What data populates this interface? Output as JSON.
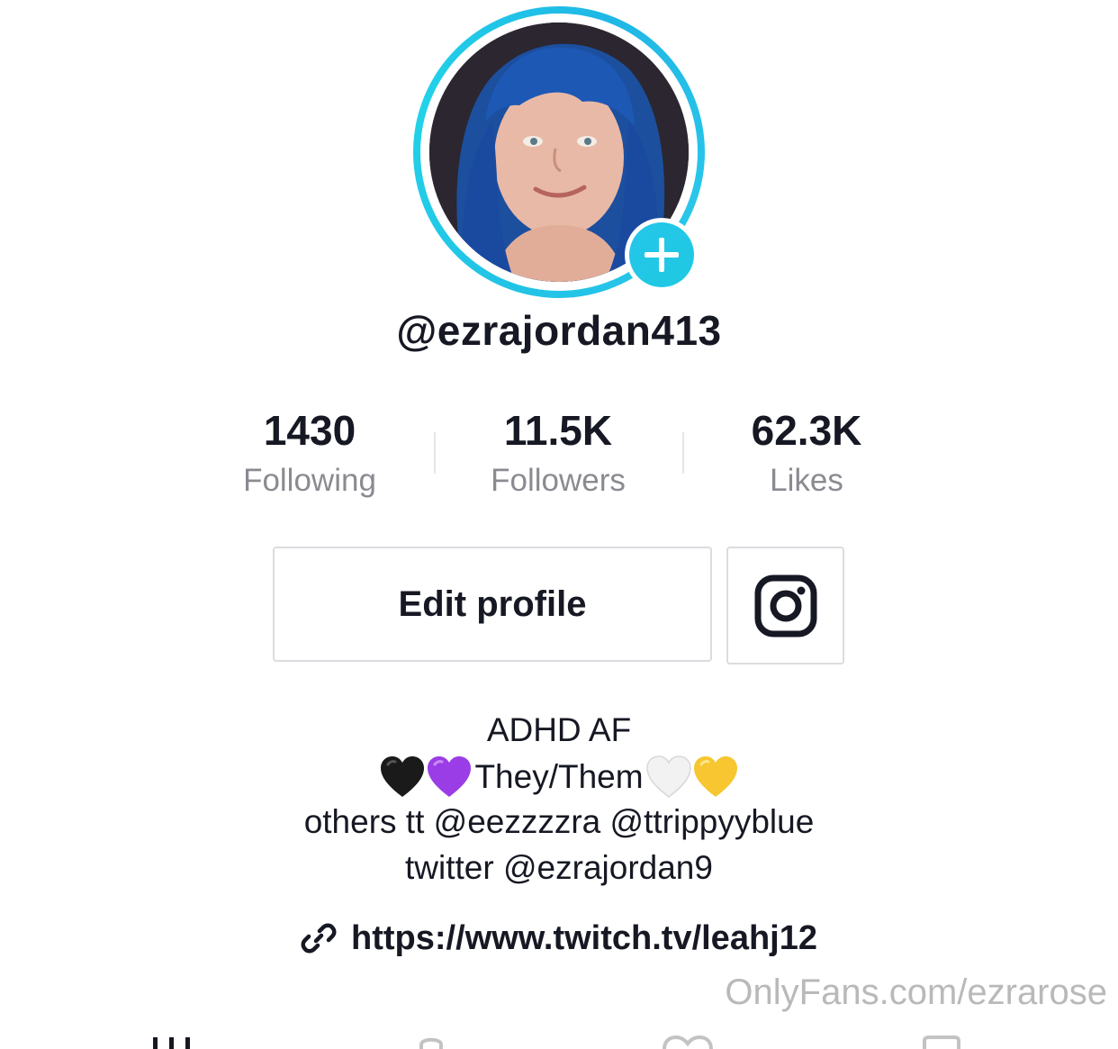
{
  "profile": {
    "username": "@ezrajordan413"
  },
  "stats": [
    {
      "value": "1430",
      "label": "Following"
    },
    {
      "value": "11.5K",
      "label": "Followers"
    },
    {
      "value": "62.3K",
      "label": "Likes"
    }
  ],
  "buttons": {
    "edit_profile": "Edit profile",
    "instagram_icon": "instagram-icon"
  },
  "bio": {
    "line1": "ADHD AF",
    "line2_text": "They/Them",
    "line2_hearts_before": [
      "black",
      "purple"
    ],
    "line2_hearts_after": [
      "white",
      "yellow"
    ],
    "line3": "others tt @eezzzzra @ttrippyyblue",
    "line4": "twitter @ezrajordan9"
  },
  "link": {
    "url": "https://www.twitch.tv/leahj12",
    "icon": "link-icon"
  },
  "watermark": "OnlyFans.com/ezrarose",
  "tabs": [
    "grid-icon",
    "lock-icon",
    "heart-icon",
    "bookmark-icon"
  ],
  "colors": {
    "accent": "#21c3e6",
    "text": "#161823",
    "secondary_text": "#8a8b91",
    "border": "#dcdce0"
  }
}
